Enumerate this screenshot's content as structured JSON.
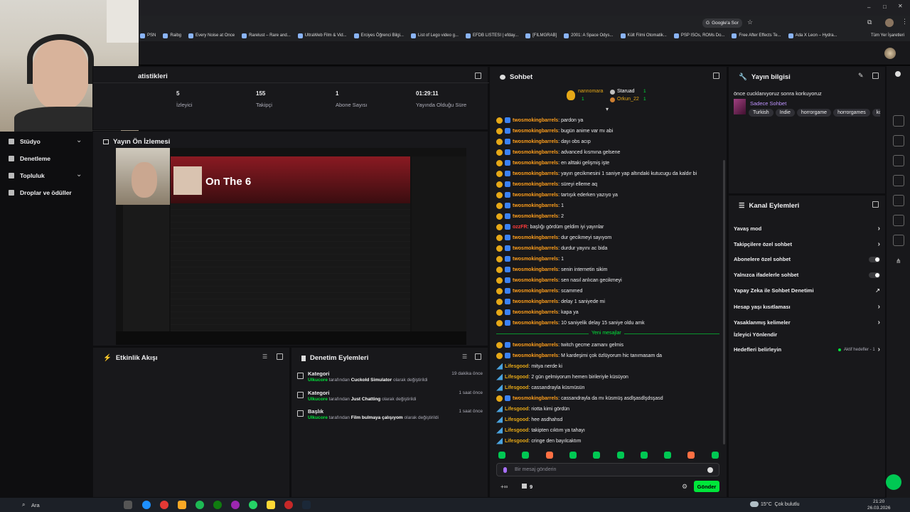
{
  "browser": {
    "search_chip": "Google'a Sor",
    "bookmarks": [
      "PSN",
      "Raibg",
      "Every Noise at Once",
      "Rarelust – Rare and...",
      "UltraWeb Film & Vid...",
      "Erciyes Öğrenci Bilgi...",
      "List of Lego video g...",
      "EFDB LISTESI | efday...",
      "[FILMGRAB]",
      "2001: A Space Odys...",
      "Kült Filmi Otomatik...",
      "PSP ISOs, ROMs Do...",
      "Free After Effects Te...",
      "Ada X Leon – Hydra..."
    ],
    "all_bookmarks": "Tüm Yer İşaretleri"
  },
  "nav": {
    "items": [
      {
        "label": "Stüdyo",
        "chevron": true
      },
      {
        "label": "Denetleme",
        "chevron": false
      },
      {
        "label": "Topluluk",
        "chevron": true
      },
      {
        "label": "Droplar ve ödüller",
        "chevron": false
      }
    ]
  },
  "stats": {
    "title": "atistikleri",
    "items": [
      {
        "value": "5",
        "label": "İzleyici"
      },
      {
        "value": "155",
        "label": "Takipçi"
      },
      {
        "value": "1",
        "label": "Abone Sayısı"
      },
      {
        "value": "01:29:11",
        "label": "Yayında Olduğu Süre"
      }
    ]
  },
  "preview": {
    "title": "Yayın Ön İzlemesi",
    "song_title": "On The 6"
  },
  "activity": {
    "title": "Etkinlik Akışı"
  },
  "modactions": {
    "title": "Denetim Eylemleri",
    "items": [
      {
        "type": "Kategori",
        "time": "19 dakika önce",
        "user": "Ulkucore",
        "pre": "tarafından",
        "value": "Cuckold Simulator",
        "post": "olarak değiştirildi"
      },
      {
        "type": "Kategori",
        "time": "1 saat önce",
        "user": "Ulkucore",
        "pre": "tarafından",
        "value": "Just Chatting",
        "post": "olarak değiştirildi"
      },
      {
        "type": "Başlık",
        "time": "1 saat önce",
        "user": "Ulkucore",
        "pre": "tarafından",
        "value": "Film bulmaya çalışıyom",
        "post": "olarak değiştirildi"
      }
    ]
  },
  "chat": {
    "title": "Sohbet",
    "leaderboard": {
      "first": {
        "name": "nannomara",
        "count": "1"
      },
      "second": {
        "name": "Staruad",
        "count": "1"
      },
      "third": {
        "name": "Orkun_22",
        "count": "1"
      }
    },
    "messages": [
      {
        "user": "twosmokingbarrels",
        "text": ": pardon ya"
      },
      {
        "user": "twosmokingbarrels",
        "text": ": bugün anime var mı abi"
      },
      {
        "user": "twosmokingbarrels",
        "text": ": dayı obs acıp"
      },
      {
        "user": "twosmokingbarrels",
        "text": ": advanced kısmına gelsene"
      },
      {
        "user": "twosmokingbarrels",
        "text": ": en alttaki gelişmiş işte"
      },
      {
        "user": "twosmokingbarrels",
        "text": ": yayın gecikmesini 1 saniye yap altındaki kutucugu da kaldır bi"
      },
      {
        "user": "twosmokingbarrels",
        "text": ": süreyi elleme aq"
      },
      {
        "user": "twosmokingbarrels",
        "text": ": tartışık ederken yazıyo ya"
      },
      {
        "user": "twosmokingbarrels",
        "text": ": 1"
      },
      {
        "user": "twosmokingbarrels",
        "text": ": 2"
      },
      {
        "user": "ozzFR",
        "text": ": başlığı gördüm geldim iyi yayınlar"
      },
      {
        "user": "twosmokingbarrels",
        "text": ": dur gecikmeyi sayıyom"
      },
      {
        "user": "twosmokingbarrels",
        "text": ": durdur yayını ac bida"
      },
      {
        "user": "twosmokingbarrels",
        "text": ": 1"
      },
      {
        "user": "twosmokingbarrels",
        "text": ": senin internetin sikim"
      },
      {
        "user": "twosmokingbarrels",
        "text": ": sen nasıl anlıcan gecikmeyi"
      },
      {
        "user": "twosmokingbarrels",
        "text": ": scammed"
      },
      {
        "user": "twosmokingbarrels",
        "text": ": delay 1 saniyede mi"
      },
      {
        "user": "twosmokingbarrels",
        "text": ": kapa ya"
      },
      {
        "user": "twosmokingbarrels",
        "text": ": 10 saniyelik delay 15 saniye oldu amk"
      }
    ],
    "new_messages_label": "Yeni mesajlar",
    "messages_new": [
      {
        "user": "twosmokingbarrels",
        "text": ": twitch gecme zamanı gelmis",
        "kind": "gold"
      },
      {
        "user": "twosmokingbarrels",
        "text": ": M kardeşimi çok özlüyorum hic tanımasam da",
        "kind": "gold"
      },
      {
        "user": "Lifesgood",
        "text": ": mitya nerde ki",
        "kind": "bot"
      },
      {
        "user": "Lifesgood",
        "text": ": 2 gün gelmiyorum hemen birileriyle küsüyon",
        "kind": "bot"
      },
      {
        "user": "Lifesgood",
        "text": ": cassandrayla küsmüsün",
        "kind": "bot"
      },
      {
        "user": "twosmokingbarrels",
        "text": ": cassandrayla da mı küsmüş asdlşasdlşdsşasd",
        "kind": "gold"
      },
      {
        "user": "Lifesgood",
        "text": ": riotta kimi gördün",
        "kind": "bot"
      },
      {
        "user": "Lifesgood",
        "text": ": hee asdhahsd",
        "kind": "bot"
      },
      {
        "user": "Lifesgood",
        "text": ": takipten cıktım ya tahayı",
        "kind": "bot"
      },
      {
        "user": "Lifesgood",
        "text": ": cringe den bayılcaktım",
        "kind": "bot"
      }
    ],
    "input_placeholder": "Bir mesaj gönderin",
    "points": "9",
    "send_label": "Gönder"
  },
  "streaminfo": {
    "title": "Yayın bilgisi",
    "stream_title": "önce cucklanıyoruz sonra korkuyoruz",
    "category": "Sadece Sohbet",
    "tags": [
      "Turkish",
      "Indie",
      "horrorgame",
      "horrorgames",
      "kor"
    ]
  },
  "channel_actions": {
    "title": "Kanal Eylemleri",
    "items": [
      {
        "label": "Yavaş mod",
        "control": "chevron"
      },
      {
        "label": "Takipçilere özel sohbet",
        "control": "chevron"
      },
      {
        "label": "Abonelere özel sohbet",
        "control": "toggle"
      },
      {
        "label": "Yalnızca ifadelerle sohbet",
        "control": "toggle"
      },
      {
        "label": "Yapay Zeka ile Sohbet Denetimi",
        "control": "external"
      },
      {
        "label": "Hesap yaşı kısıtlaması",
        "control": "chevron"
      },
      {
        "label": "Yasaklanmış kelimeler",
        "control": "chevron"
      },
      {
        "label": "İzleyici Yönlendir",
        "control": "none"
      },
      {
        "label": "Hedefleri belirleyin",
        "control": "chevron",
        "status": "Aktif hedefler - 1"
      }
    ]
  },
  "taskbar": {
    "search": "Ara",
    "weather": "15°C  Çok bulutlu",
    "time": "21:20",
    "date": "26.03.2026"
  },
  "colors": {
    "accent": "#00e63a",
    "panel": "#18181b",
    "bg": "#0e0e10",
    "gold": "#e6a817"
  }
}
